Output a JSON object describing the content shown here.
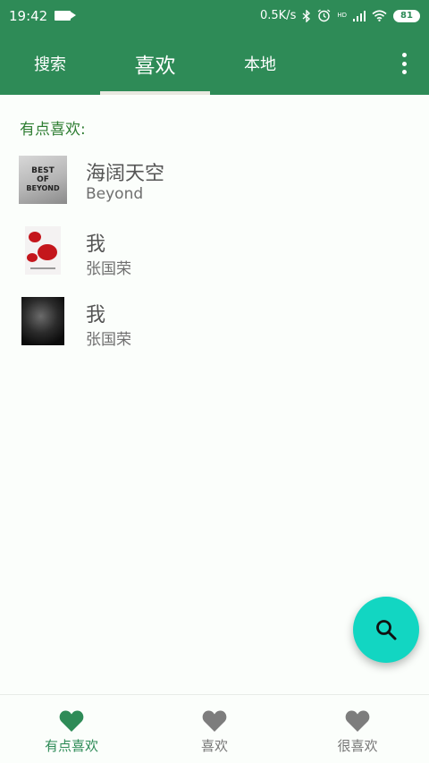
{
  "status_bar": {
    "time": "19:42",
    "net_speed": "0.5K/s",
    "signal_label": "HD",
    "battery": "81",
    "icons": [
      "video-camera-icon",
      "bluetooth-icon",
      "alarm-icon",
      "signal-icon",
      "wifi-icon",
      "battery-icon"
    ]
  },
  "tabs": [
    {
      "label": "搜索",
      "active": false
    },
    {
      "label": "喜欢",
      "active": true
    },
    {
      "label": "本地",
      "active": false
    }
  ],
  "section_label": "有点喜欢:",
  "songs": [
    {
      "title": "海阔天空",
      "artist": "Beyond",
      "cover_text": [
        "BEST",
        "OF",
        "BEYOND"
      ]
    },
    {
      "title": "我",
      "artist": "张国荣"
    },
    {
      "title": "我",
      "artist": "张国荣"
    }
  ],
  "bottom_nav": [
    {
      "label": "有点喜欢",
      "active": true,
      "icon": "heart-icon"
    },
    {
      "label": "喜欢",
      "active": false,
      "icon": "heart-icon"
    },
    {
      "label": "很喜欢",
      "active": false,
      "icon": "heart-icon"
    }
  ],
  "colors": {
    "primary": "#2e8b57",
    "fab": "#12d6c2",
    "inactive_icon": "#7d7d7d",
    "section_label": "#2e7d32"
  }
}
